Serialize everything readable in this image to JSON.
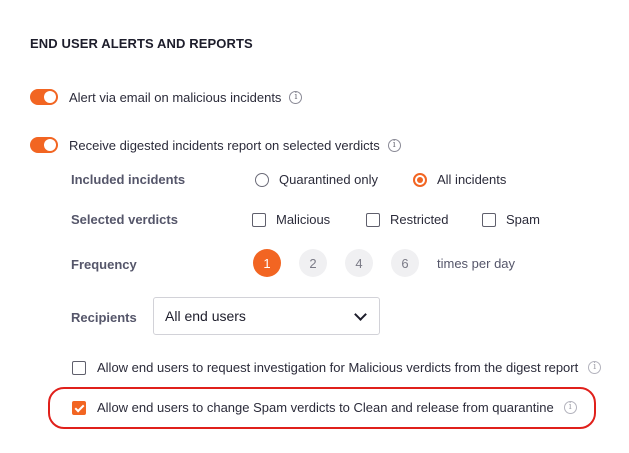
{
  "section": {
    "title": "END USER ALERTS AND REPORTS"
  },
  "alert_email": {
    "label": "Alert via email on malicious incidents",
    "enabled": true
  },
  "digest": {
    "label": "Receive digested incidents report on selected verdicts",
    "enabled": true,
    "included_incidents": {
      "label": "Included incidents",
      "options": [
        {
          "label": "Quarantined only",
          "selected": false
        },
        {
          "label": "All incidents",
          "selected": true
        }
      ]
    },
    "selected_verdicts": {
      "label": "Selected verdicts",
      "options": [
        {
          "label": "Malicious",
          "checked": false
        },
        {
          "label": "Restricted",
          "checked": false
        },
        {
          "label": "Spam",
          "checked": false
        }
      ]
    },
    "frequency": {
      "label": "Frequency",
      "options": [
        "1",
        "2",
        "4",
        "6"
      ],
      "selected": "1",
      "suffix": "times per day"
    },
    "recipients": {
      "label": "Recipients",
      "value": "All end users"
    }
  },
  "allow_investigation": {
    "label": "Allow end users to request investigation for Malicious verdicts from the digest report",
    "checked": false
  },
  "allow_release": {
    "label": "Allow end users to change Spam verdicts to Clean and release from quarantine",
    "checked": true
  },
  "colors": {
    "accent": "#f26522",
    "highlight": "#e0201b"
  }
}
